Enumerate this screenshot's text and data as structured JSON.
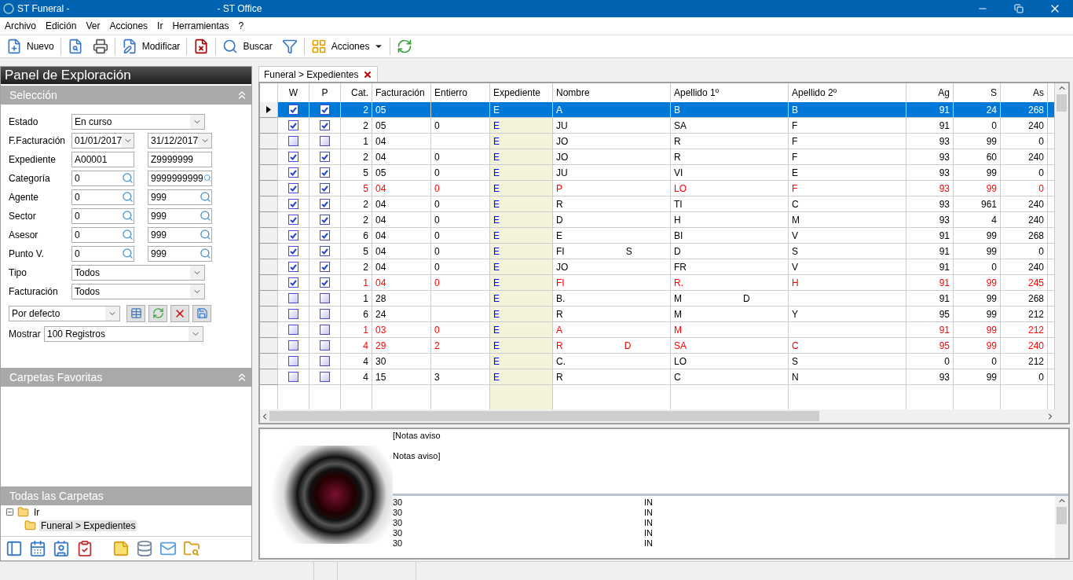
{
  "window": {
    "title": "ST Funeral -",
    "subtitle": "- ST Office"
  },
  "menu": [
    "Archivo",
    "Edición",
    "Ver",
    "Acciones",
    "Ir",
    "Herramientas",
    "?"
  ],
  "toolbar": [
    {
      "kind": "button",
      "label": "Nuevo"
    },
    {
      "kind": "separator"
    },
    {
      "kind": "button"
    },
    {
      "kind": "button"
    },
    {
      "kind": "separator"
    },
    {
      "kind": "button",
      "label": "Modificar"
    },
    {
      "kind": "separator"
    },
    {
      "kind": "button"
    },
    {
      "kind": "separator"
    },
    {
      "kind": "button",
      "label": "Buscar"
    },
    {
      "kind": "button"
    },
    {
      "kind": "separator"
    },
    {
      "kind": "dropdown",
      "label": "Acciones"
    },
    {
      "kind": "separator"
    },
    {
      "kind": "button"
    }
  ],
  "panel": {
    "title": "Panel de Exploración",
    "selection": {
      "title": "Selección",
      "fields": [
        {
          "kind": "select",
          "label": "Estado",
          "value": "En curso"
        },
        {
          "kind": "date_range",
          "label": "F.Facturación",
          "from": "01/01/2017",
          "to": "31/12/2017"
        },
        {
          "kind": "text_range",
          "label": "Expediente",
          "from": "A00001",
          "to": "Z9999999"
        },
        {
          "kind": "lookup_range",
          "label": "Categoría",
          "from": "0",
          "to": "9999999999"
        },
        {
          "kind": "lookup_range",
          "label": "Agente",
          "from": "0",
          "to": "999"
        },
        {
          "kind": "lookup_range",
          "label": "Sector",
          "from": "0",
          "to": "999"
        },
        {
          "kind": "lookup_range",
          "label": "Asesor",
          "from": "0",
          "to": "999"
        },
        {
          "kind": "lookup_range",
          "label": "Punto V.",
          "from": "0",
          "to": "999"
        },
        {
          "kind": "select",
          "label": "Tipo",
          "value": "Todos"
        },
        {
          "kind": "select",
          "label": "Facturación",
          "value": "Todos"
        }
      ],
      "preset": "Por defecto",
      "show_label": "Mostrar",
      "show_value": "100  Registros"
    },
    "favorites": {
      "title": "Carpetas Favoritas"
    },
    "all_folders": {
      "title": "Todas las Carpetas",
      "tree": [
        {
          "label": "Ir",
          "expanded": true,
          "selected": false,
          "children": [
            {
              "label": "Funeral > Expedientes",
              "selected": true
            }
          ]
        }
      ]
    }
  },
  "tabs": [
    {
      "label": "Funeral > Expedientes",
      "selected": true
    }
  ],
  "table": {
    "columns": [
      "W",
      "P",
      "Cat.",
      "Facturación",
      "Entierro",
      "Expediente",
      "Nombre",
      "Apellido 1º",
      "Apellido 2º",
      "Ag",
      "S",
      "As"
    ],
    "rows": [
      {
        "selected": true,
        "flagged": false,
        "w": true,
        "p": true,
        "cat": "2",
        "fact": "05",
        "ent": "",
        "exp": "E",
        "nombre": "A",
        "ap1": "B",
        "ap2": "B",
        "ag": "91",
        "s": "24",
        "as": "268"
      },
      {
        "selected": false,
        "flagged": false,
        "w": true,
        "p": true,
        "cat": "2",
        "fact": "05",
        "ent": "0",
        "exp": "E",
        "nombre": "JU",
        "ap1": "SA",
        "ap2": "F",
        "ag": "91",
        "s": "0",
        "as": "240"
      },
      {
        "selected": false,
        "flagged": false,
        "w": false,
        "p": false,
        "cat": "1",
        "fact": "04",
        "ent": "",
        "exp": "E",
        "nombre": "JO",
        "ap1": "R",
        "ap2": "F",
        "ag": "93",
        "s": "99",
        "as": "0"
      },
      {
        "selected": false,
        "flagged": false,
        "w": true,
        "p": true,
        "cat": "2",
        "fact": "04",
        "ent": "0",
        "exp": "E",
        "nombre": "JO",
        "ap1": "R",
        "ap2": "F",
        "ag": "93",
        "s": "60",
        "as": "240"
      },
      {
        "selected": false,
        "flagged": false,
        "w": true,
        "p": true,
        "cat": "5",
        "fact": "05",
        "ent": "0",
        "exp": "E",
        "nombre": "JU",
        "ap1": "VI",
        "ap2": "E",
        "ag": "93",
        "s": "99",
        "as": "0"
      },
      {
        "selected": false,
        "flagged": true,
        "w": true,
        "p": true,
        "cat": "5",
        "fact": "04",
        "ent": "0",
        "exp": "E",
        "nombre": "P",
        "ap1": "LO",
        "ap2": "F",
        "ag": "93",
        "s": "99",
        "as": "0"
      },
      {
        "selected": false,
        "flagged": false,
        "w": true,
        "p": true,
        "cat": "2",
        "fact": "04",
        "ent": "0",
        "exp": "E",
        "nombre": "R",
        "ap1": "TI",
        "ap2": "C",
        "ag": "93",
        "s": "961",
        "as": "240"
      },
      {
        "selected": false,
        "flagged": false,
        "w": true,
        "p": true,
        "cat": "2",
        "fact": "04",
        "ent": "0",
        "exp": "E",
        "nombre": "D",
        "ap1": "H",
        "ap2": "M",
        "ag": "93",
        "s": "4",
        "as": "240"
      },
      {
        "selected": false,
        "flagged": false,
        "w": true,
        "p": true,
        "cat": "6",
        "fact": "04",
        "ent": "0",
        "exp": "E",
        "nombre": "E",
        "ap1": "BI",
        "ap2": "V",
        "ag": "91",
        "s": "99",
        "as": "268"
      },
      {
        "selected": false,
        "flagged": false,
        "w": true,
        "p": true,
        "cat": "5",
        "fact": "04",
        "ent": "0",
        "exp": "E",
        "nombre": "FI",
        "nombre_tail": "S",
        "ap1": "D",
        "ap2": "S",
        "ag": "91",
        "s": "99",
        "as": "0"
      },
      {
        "selected": false,
        "flagged": false,
        "w": true,
        "p": true,
        "cat": "2",
        "fact": "04",
        "ent": "0",
        "exp": "E",
        "nombre": "JO",
        "ap1": "FR",
        "ap2": "V",
        "ag": "91",
        "s": "0",
        "as": "240"
      },
      {
        "selected": false,
        "flagged": true,
        "w": true,
        "p": true,
        "cat": "1",
        "fact": "04",
        "ent": "0",
        "exp": "E",
        "nombre": "FI",
        "ap1": "R.",
        "ap2": "H",
        "ag": "91",
        "s": "99",
        "as": "245"
      },
      {
        "selected": false,
        "flagged": false,
        "w": false,
        "p": false,
        "cat": "1",
        "fact": "28",
        "ent": "",
        "exp": "E",
        "nombre": "B.",
        "ap1": "M",
        "ap1_tail": "D",
        "ap2": "",
        "ag": "91",
        "s": "99",
        "as": "268"
      },
      {
        "selected": false,
        "flagged": false,
        "w": false,
        "p": false,
        "cat": "6",
        "fact": "24",
        "ent": "",
        "exp": "E",
        "nombre": "R",
        "ap1": "M",
        "ap2": "Y",
        "ag": "95",
        "s": "99",
        "as": "212"
      },
      {
        "selected": false,
        "flagged": true,
        "w": false,
        "p": false,
        "cat": "1",
        "fact": "03",
        "ent": "0",
        "exp": "E",
        "nombre": "A",
        "ap1": "M",
        "ap2": "",
        "ag": "91",
        "s": "99",
        "as": "212"
      },
      {
        "selected": false,
        "flagged": true,
        "w": false,
        "p": false,
        "cat": "4",
        "fact": "29",
        "ent": "2",
        "exp": "E",
        "nombre": "R",
        "nombre_tail": "D",
        "ap1": "SA",
        "ap2": "C",
        "ag": "95",
        "s": "99",
        "as": "240"
      },
      {
        "selected": false,
        "flagged": false,
        "w": false,
        "p": false,
        "cat": "4",
        "fact": "30",
        "ent": "",
        "exp": "E",
        "nombre": "C.",
        "ap1": "LO",
        "ap2": "S",
        "ag": "0",
        "s": "0",
        "as": "212"
      },
      {
        "selected": false,
        "flagged": false,
        "w": false,
        "p": false,
        "cat": "4",
        "fact": "15",
        "ent": "3",
        "exp": "E",
        "nombre": "R",
        "ap1": "C",
        "ap2": "N",
        "ag": "93",
        "s": "99",
        "as": "0"
      }
    ]
  },
  "details": {
    "notes": [
      "[Notas aviso",
      "Notas aviso]"
    ],
    "list": [
      {
        "column_1": "30",
        "column_2": "IN"
      },
      {
        "column_1": "30",
        "column_2": "IN"
      },
      {
        "column_1": "30",
        "column_2": "IN"
      },
      {
        "column_1": "30",
        "column_2": "IN"
      },
      {
        "column_1": "30",
        "column_2": "IN"
      }
    ]
  }
}
